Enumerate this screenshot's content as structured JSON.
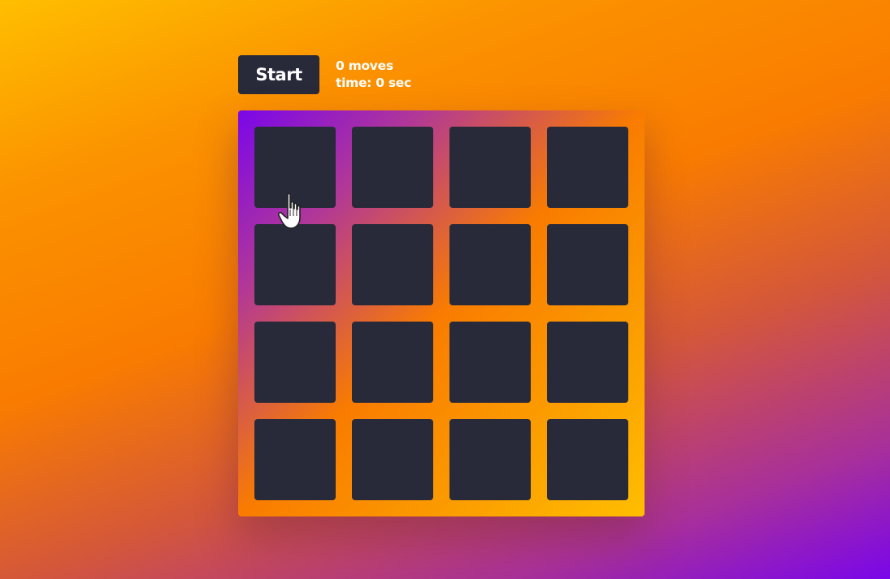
{
  "controls": {
    "start_label": "Start",
    "moves_count": "0",
    "moves_label": "moves",
    "time_label": "time:",
    "time_value": "0",
    "time_unit": "sec"
  },
  "board": {
    "rows": 4,
    "columns": 4,
    "card_color": "#282a3a",
    "cards_face_down": 16
  },
  "colors": {
    "background_start": "#ffbe00",
    "background_mid": "#f97c00",
    "background_end": "#7a06ea",
    "text": "#ffffff"
  },
  "cursor": {
    "icon": "pointer-hand-icon"
  }
}
